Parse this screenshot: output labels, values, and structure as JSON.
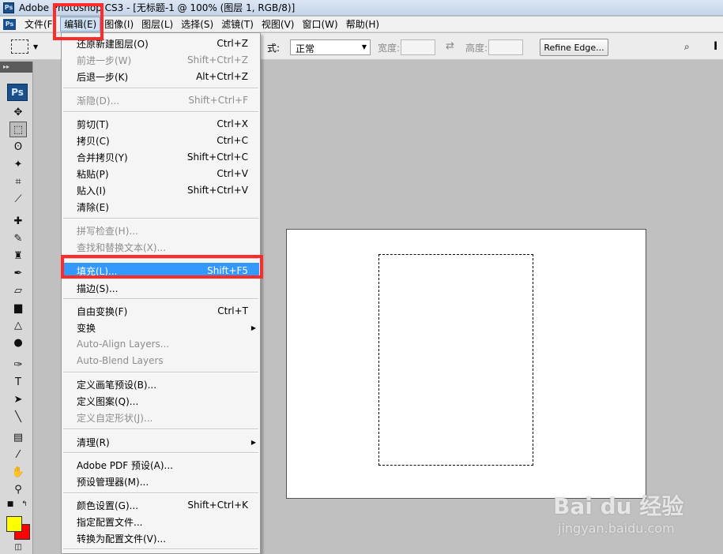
{
  "window": {
    "title": "Adobe Photoshop CS3 - [无标题-1 @ 100% (图层 1, RGB/8)]",
    "app_icon": "Ps"
  },
  "menubar": {
    "items": [
      {
        "label": "文件(F)"
      },
      {
        "label": "编辑(E)",
        "active": true
      },
      {
        "label": "图像(I)"
      },
      {
        "label": "图层(L)"
      },
      {
        "label": "选择(S)"
      },
      {
        "label": "滤镜(T)"
      },
      {
        "label": "视图(V)"
      },
      {
        "label": "窗口(W)"
      },
      {
        "label": "帮助(H)"
      }
    ]
  },
  "options": {
    "style_label": "式:",
    "style_value": "正常",
    "width_label": "宽度:",
    "height_label": "高度:",
    "refine_button": "Refine Edge..."
  },
  "toolbox": {
    "logo": "Ps",
    "foreground_color": "#ffff00",
    "background_color": "#ff0000"
  },
  "edit_menu": {
    "groups": [
      [
        {
          "label": "还原新建图层(O)",
          "shortcut": "Ctrl+Z"
        },
        {
          "label": "前进一步(W)",
          "shortcut": "Shift+Ctrl+Z",
          "disabled": true
        },
        {
          "label": "后退一步(K)",
          "shortcut": "Alt+Ctrl+Z"
        }
      ],
      [
        {
          "label": "渐隐(D)...",
          "shortcut": "Shift+Ctrl+F",
          "disabled": true
        }
      ],
      [
        {
          "label": "剪切(T)",
          "shortcut": "Ctrl+X"
        },
        {
          "label": "拷贝(C)",
          "shortcut": "Ctrl+C"
        },
        {
          "label": "合并拷贝(Y)",
          "shortcut": "Shift+Ctrl+C"
        },
        {
          "label": "粘贴(P)",
          "shortcut": "Ctrl+V"
        },
        {
          "label": "贴入(I)",
          "shortcut": "Shift+Ctrl+V"
        },
        {
          "label": "清除(E)",
          "shortcut": ""
        }
      ],
      [
        {
          "label": "拼写检查(H)...",
          "shortcut": "",
          "disabled": true
        },
        {
          "label": "查找和替换文本(X)...",
          "shortcut": "",
          "disabled": true
        }
      ],
      [
        {
          "label": "填充(L)...",
          "shortcut": "Shift+F5",
          "highlighted": true
        },
        {
          "label": "描边(S)...",
          "shortcut": ""
        }
      ],
      [
        {
          "label": "自由变换(F)",
          "shortcut": "Ctrl+T"
        },
        {
          "label": "变换",
          "shortcut": "",
          "submenu": true
        },
        {
          "label": "Auto-Align Layers...",
          "shortcut": "",
          "disabled": true
        },
        {
          "label": "Auto-Blend Layers",
          "shortcut": "",
          "disabled": true
        }
      ],
      [
        {
          "label": "定义画笔预设(B)...",
          "shortcut": ""
        },
        {
          "label": "定义图案(Q)...",
          "shortcut": ""
        },
        {
          "label": "定义自定形状(J)...",
          "shortcut": "",
          "disabled": true
        }
      ],
      [
        {
          "label": "清理(R)",
          "shortcut": "",
          "submenu": true
        }
      ],
      [
        {
          "label": "Adobe PDF 预设(A)...",
          "shortcut": ""
        },
        {
          "label": "预设管理器(M)...",
          "shortcut": ""
        }
      ],
      [
        {
          "label": "颜色设置(G)...",
          "shortcut": "Shift+Ctrl+K"
        },
        {
          "label": "指定配置文件...",
          "shortcut": ""
        },
        {
          "label": "转换为配置文件(V)...",
          "shortcut": ""
        }
      ]
    ]
  },
  "watermark": {
    "brand": "Bai du 经验",
    "url": "jingyan.baidu.com"
  }
}
